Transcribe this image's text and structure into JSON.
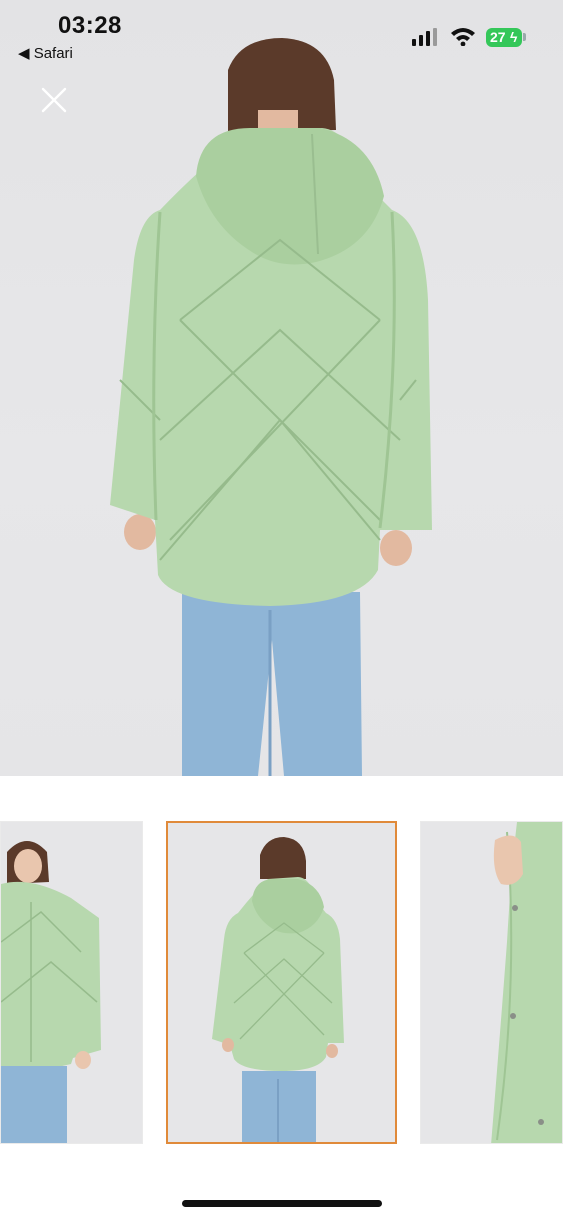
{
  "status_bar": {
    "time": "03:28",
    "back_app": "◀ Safari",
    "battery": "27"
  },
  "colors": {
    "jacket": "#b7d8ae",
    "jeans": "#8fb5d6",
    "selected_border": "#e08a3a",
    "battery": "#34c759"
  },
  "icons": {
    "close": "close-icon",
    "signal": "cellular-signal-icon",
    "wifi": "wifi-icon",
    "battery": "battery-charging-icon"
  },
  "gallery": {
    "thumbnail_count": 3,
    "selected_index": 1
  }
}
